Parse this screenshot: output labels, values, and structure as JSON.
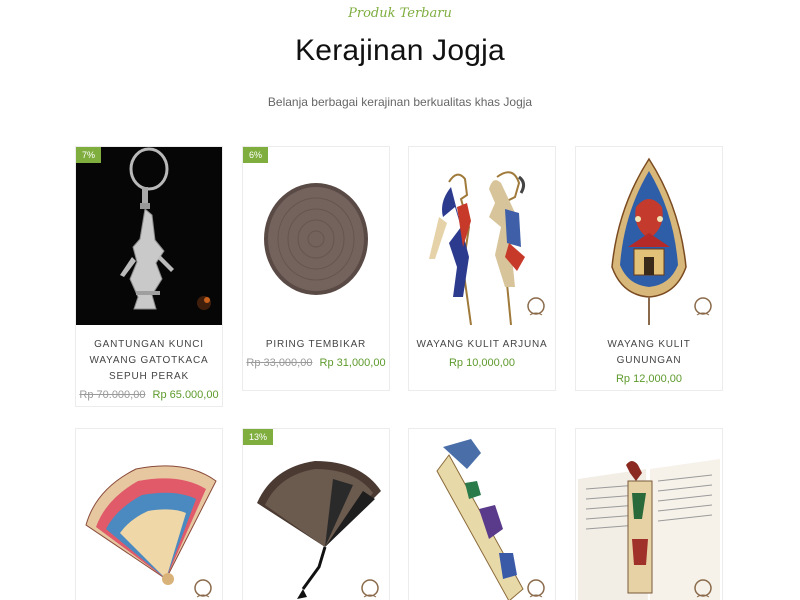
{
  "section": {
    "eyebrow": "Produk Terbaru",
    "title": "Kerajinan Jogja",
    "tagline": "Belanja berbagai kerajinan berkualitas khas Jogja"
  },
  "colors": {
    "accent": "#7fae3f",
    "price": "#5e9a2c"
  },
  "products": [
    {
      "badge": "7%",
      "name": "GANTUNGAN KUNCI WAYANG GATOTKACA SEPUH PERAK",
      "old_price": "Rp 70.000,00",
      "price": "Rp 65.000,00",
      "image_icon": "keychain-wayang-icon"
    },
    {
      "badge": "6%",
      "name": "PIRING TEMBIKAR",
      "old_price": "Rp 33,000,00",
      "price": "Rp 31,000,00",
      "image_icon": "plate-icon"
    },
    {
      "badge": "",
      "name": "WAYANG KULIT ARJUNA",
      "old_price": "",
      "price": "Rp 10,000,00",
      "image_icon": "wayang-arjuna-icon"
    },
    {
      "badge": "",
      "name": "WAYANG KULIT GUNUNGAN",
      "old_price": "",
      "price": "Rp 12,000,00",
      "image_icon": "gunungan-icon"
    },
    {
      "badge": "",
      "name": "",
      "old_price": "",
      "price": "",
      "image_icon": "batik-fan-icon"
    },
    {
      "badge": "13%",
      "name": "",
      "old_price": "",
      "price": "",
      "image_icon": "black-fan-icon"
    },
    {
      "badge": "",
      "name": "",
      "old_price": "",
      "price": "",
      "image_icon": "wayang-bookmark-icon"
    },
    {
      "badge": "",
      "name": "",
      "old_price": "",
      "price": "",
      "image_icon": "book-bookmark-icon"
    }
  ]
}
